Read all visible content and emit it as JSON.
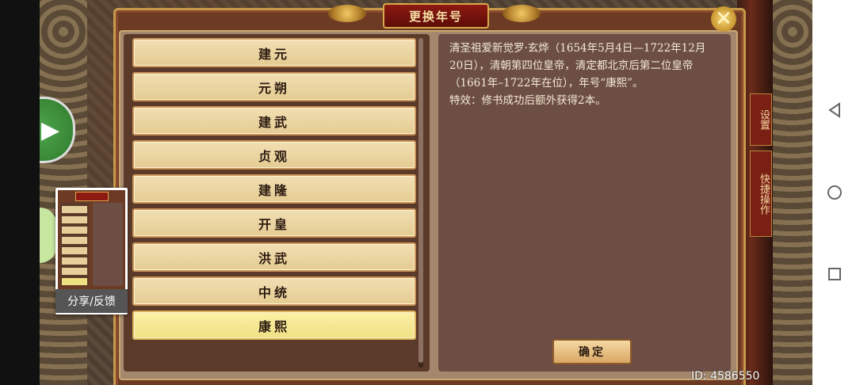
{
  "dialog": {
    "title": "更换年号",
    "close_icon": "close-icon",
    "confirm_label": "确定"
  },
  "era_list": {
    "items": [
      {
        "label": "建元",
        "selected": false
      },
      {
        "label": "元朔",
        "selected": false
      },
      {
        "label": "建武",
        "selected": false
      },
      {
        "label": "贞观",
        "selected": false
      },
      {
        "label": "建隆",
        "selected": false
      },
      {
        "label": "开皇",
        "selected": false
      },
      {
        "label": "洪武",
        "selected": false
      },
      {
        "label": "中统",
        "selected": false
      },
      {
        "label": "康熙",
        "selected": true
      }
    ]
  },
  "description": {
    "line1": "清圣祖爱新觉罗·玄烨（1654年5月4日—1722年12月20日），清朝第四位皇帝，清定都北京后第二位皇帝（1661年–1722年在位），年号“康熙”。",
    "line2": "特效：修书成功后额外获得2本。"
  },
  "side_tags": {
    "settings": "设置",
    "quick_ops": "快捷操作"
  },
  "share_card": {
    "label": "分享/反馈"
  },
  "footer": {
    "id_text": "ID: 4586550"
  },
  "nav": {
    "back_icon": "back-triangle-icon",
    "home_icon": "home-circle-icon",
    "recent_icon": "recent-square-icon"
  }
}
